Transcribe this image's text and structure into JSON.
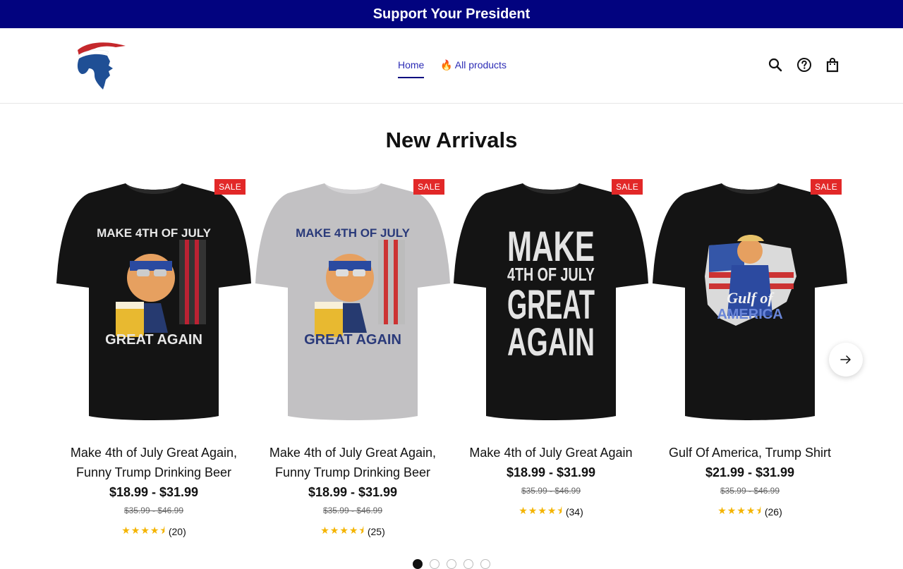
{
  "announcement": {
    "text": "Support Your President"
  },
  "nav": {
    "items": [
      {
        "label": "Home"
      },
      {
        "label": "All products",
        "icon": "fire-icon"
      }
    ]
  },
  "header_icons": [
    "search-icon",
    "help-icon",
    "bag-icon"
  ],
  "section": {
    "title": "New Arrivals"
  },
  "products": [
    {
      "badge": "SALE",
      "title": "Make 4th of July Great Again, Funny Trump Drinking Beer",
      "price": "$18.99 - $31.99",
      "compare": "$35.99 - $46.99",
      "rating_value": 4.5,
      "reviews": "(20)",
      "shirt_color": "#141414",
      "print_text_top": "MAKE 4TH OF JULY",
      "print_text_bottom": "GREAT AGAIN"
    },
    {
      "badge": "SALE",
      "title": "Make 4th of July Great Again, Funny Trump Drinking Beer",
      "price": "$18.99 - $31.99",
      "compare": "$35.99 - $46.99",
      "rating_value": 4.5,
      "reviews": "(25)",
      "shirt_color": "#c2c1c3",
      "print_text_top": "MAKE 4TH OF JULY",
      "print_text_bottom": "GREAT AGAIN"
    },
    {
      "badge": "SALE",
      "title": "Make 4th of July Great Again",
      "price": "$18.99 - $31.99",
      "compare": "$35.99 - $46.99",
      "rating_value": 4.5,
      "reviews": "(34)",
      "shirt_color": "#141414",
      "print_text_lines": [
        "MAKE",
        "4TH OF JULY",
        "GREAT",
        "AGAIN"
      ]
    },
    {
      "badge": "SALE",
      "title": "Gulf Of America, Trump Shirt",
      "price": "$21.99 - $31.99",
      "compare": "$35.99 - $46.99",
      "rating_value": 4.5,
      "reviews": "(26)",
      "shirt_color": "#141414",
      "print_text_top": "Gulf of",
      "print_text_bottom": "AMERICA"
    }
  ],
  "pagination": {
    "count": 5,
    "active": 0
  },
  "colors": {
    "announcement_bg": "#02037f",
    "nav_link": "#2b2bb5",
    "sale_badge": "#e22828",
    "star": "#f4b400"
  }
}
